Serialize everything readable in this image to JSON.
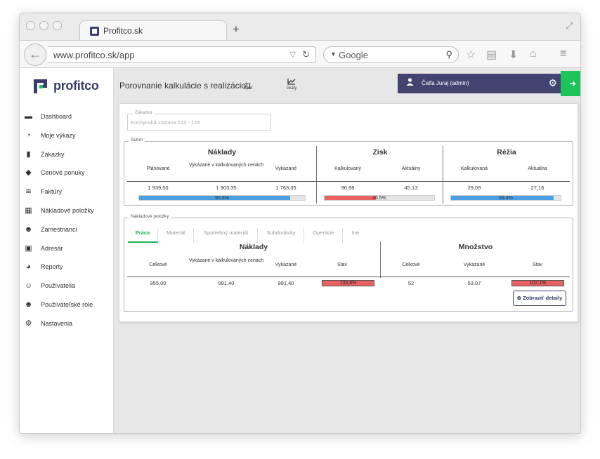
{
  "browser": {
    "tab_title": "Profitco.sk",
    "new_tab": "+",
    "url": "www.profitco.sk/app",
    "search_placeholder": "Google"
  },
  "logo": {
    "text": "profitco"
  },
  "sidebar": {
    "items": [
      {
        "label": "Dashboard",
        "icon": "dashboard-icon"
      },
      {
        "label": "Moje výkazy",
        "icon": "clock-icon"
      },
      {
        "label": "Zákazky",
        "icon": "document-icon"
      },
      {
        "label": "Cenové ponuky",
        "icon": "tags-icon"
      },
      {
        "label": "Faktúry",
        "icon": "layers-icon"
      },
      {
        "label": "Nákladové položky",
        "icon": "coins-icon"
      },
      {
        "label": "Zamestnanci",
        "icon": "users-icon"
      },
      {
        "label": "Adresár",
        "icon": "address-book-icon"
      },
      {
        "label": "Reporty",
        "icon": "pie-chart-icon"
      },
      {
        "label": "Používatelia",
        "icon": "user-cog-icon"
      },
      {
        "label": "Používateľské role",
        "icon": "users-cog-icon"
      },
      {
        "label": "Nastavenia",
        "icon": "cogs-icon"
      }
    ]
  },
  "header": {
    "title": "Porovnanie kalkulácie s realizáciou",
    "back_label": "Späť",
    "charts_label": "Grafy",
    "user": "Čalfa Juraj (admin)"
  },
  "order": {
    "legend": "Zákazka",
    "value": "Kuchynská zostava 123 - 124"
  },
  "summary": {
    "legend": "Súhrn",
    "naklady": {
      "title": "Náklady",
      "col1": "Plánované",
      "col2": "Vykázané v kalkulovaných cenách",
      "col3": "Vykázané",
      "val1": "1 939,50",
      "val2": "1 903,35",
      "val3": "1 763,35",
      "progress_label": "90.9%",
      "progress": 90.9
    },
    "zisk": {
      "title": "Zisk",
      "col1": "Kalkulovaný",
      "col2": "Aktuálny",
      "val1": "96,98",
      "val2": "45,13",
      "progress_label": "46.5%",
      "progress": 46.5
    },
    "rezia": {
      "title": "Réžia",
      "col1": "Kalkulovaná",
      "col2": "Aktuálna",
      "val1": "29,09",
      "val2": "27,16",
      "progress_label": "93.4%",
      "progress": 93.4
    }
  },
  "cost_items": {
    "legend": "Nákladové položky",
    "tabs": [
      "Práca",
      "Materiál",
      "Spotrebný materiál",
      "Subdodávky",
      "Operácie",
      "Iné"
    ],
    "naklady": {
      "title": "Náklady",
      "col1": "Celkové",
      "col2": "Vykázané v kalkulovaných cenách",
      "col3": "Vykázané",
      "col4": "Stav",
      "val1": "955,00",
      "val2": "991,40",
      "val3": "991,40",
      "status": "103.8%"
    },
    "mnozstvo": {
      "title": "Množstvo",
      "col1": "Celkové",
      "col2": "Vykázané",
      "col3": "Stav",
      "val1": "52",
      "val2": "53.07",
      "status": "102.1%"
    },
    "details_button": "Zobraziť detaily"
  },
  "colors": {
    "accent_green": "#1db055",
    "brand_dark": "#434370",
    "bar_blue": "#4a9fe0",
    "bar_red": "#e86262"
  }
}
